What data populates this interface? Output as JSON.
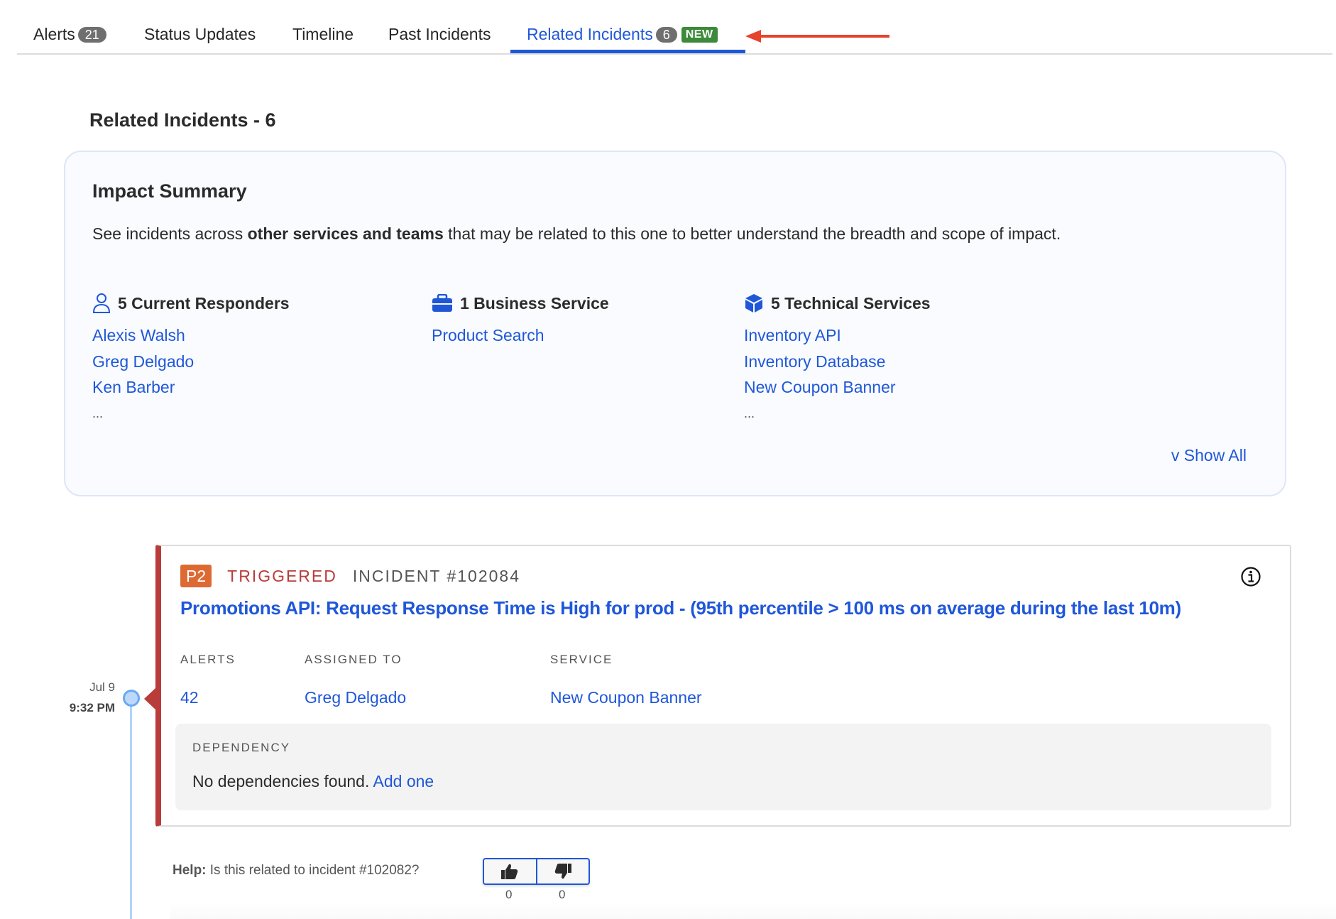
{
  "tabs": [
    {
      "label": "Alerts",
      "count": "21"
    },
    {
      "label": "Status Updates"
    },
    {
      "label": "Timeline"
    },
    {
      "label": "Past Incidents"
    },
    {
      "label": "Related Incidents",
      "count": "6",
      "badge": "NEW",
      "active": true
    }
  ],
  "colors": {
    "accent": "#1f57d9",
    "triggered": "#b83d3a",
    "priority_p2": "#dd6a32",
    "new_badge": "#3c8a3a",
    "annotation_arrow": "#e8412c"
  },
  "section_title": "Related Incidents - 6",
  "impact": {
    "title": "Impact Summary",
    "desc_pre": "See incidents across ",
    "desc_bold": "other services and teams",
    "desc_post": " that may be related to this one to better understand the breadth and scope of impact.",
    "columns": [
      {
        "icon": "user-icon",
        "heading": "5 Current Responders",
        "items": [
          "Alexis Walsh",
          "Greg Delgado",
          "Ken Barber"
        ],
        "more": "..."
      },
      {
        "icon": "briefcase-icon",
        "heading": "1 Business Service",
        "items": [
          "Product Search"
        ],
        "more": ""
      },
      {
        "icon": "cube-icon",
        "heading": "5 Technical Services",
        "items": [
          "Inventory API",
          "Inventory Database",
          "New Coupon Banner"
        ],
        "more": "..."
      }
    ],
    "show_all": "v Show All"
  },
  "incident": {
    "date": "Jul 9",
    "time": "9:32 PM",
    "priority": "P2",
    "status": "TRIGGERED",
    "number": "INCIDENT #102084",
    "title": "Promotions API: Request Response Time is High for prod - (95th percentile > 100 ms on average during the last 10m)",
    "fields": [
      {
        "label": "ALERTS",
        "value": "42"
      },
      {
        "label": "ASSIGNED TO",
        "value": "Greg Delgado"
      },
      {
        "label": "SERVICE",
        "value": "New Coupon Banner"
      }
    ],
    "dependency": {
      "label": "DEPENDENCY",
      "text": "No dependencies found.",
      "link": "Add one"
    }
  },
  "help": {
    "prefix": "Help:",
    "question": " Is this related to incident #102082?",
    "thumbs_up_count": "0",
    "thumbs_down_count": "0"
  }
}
